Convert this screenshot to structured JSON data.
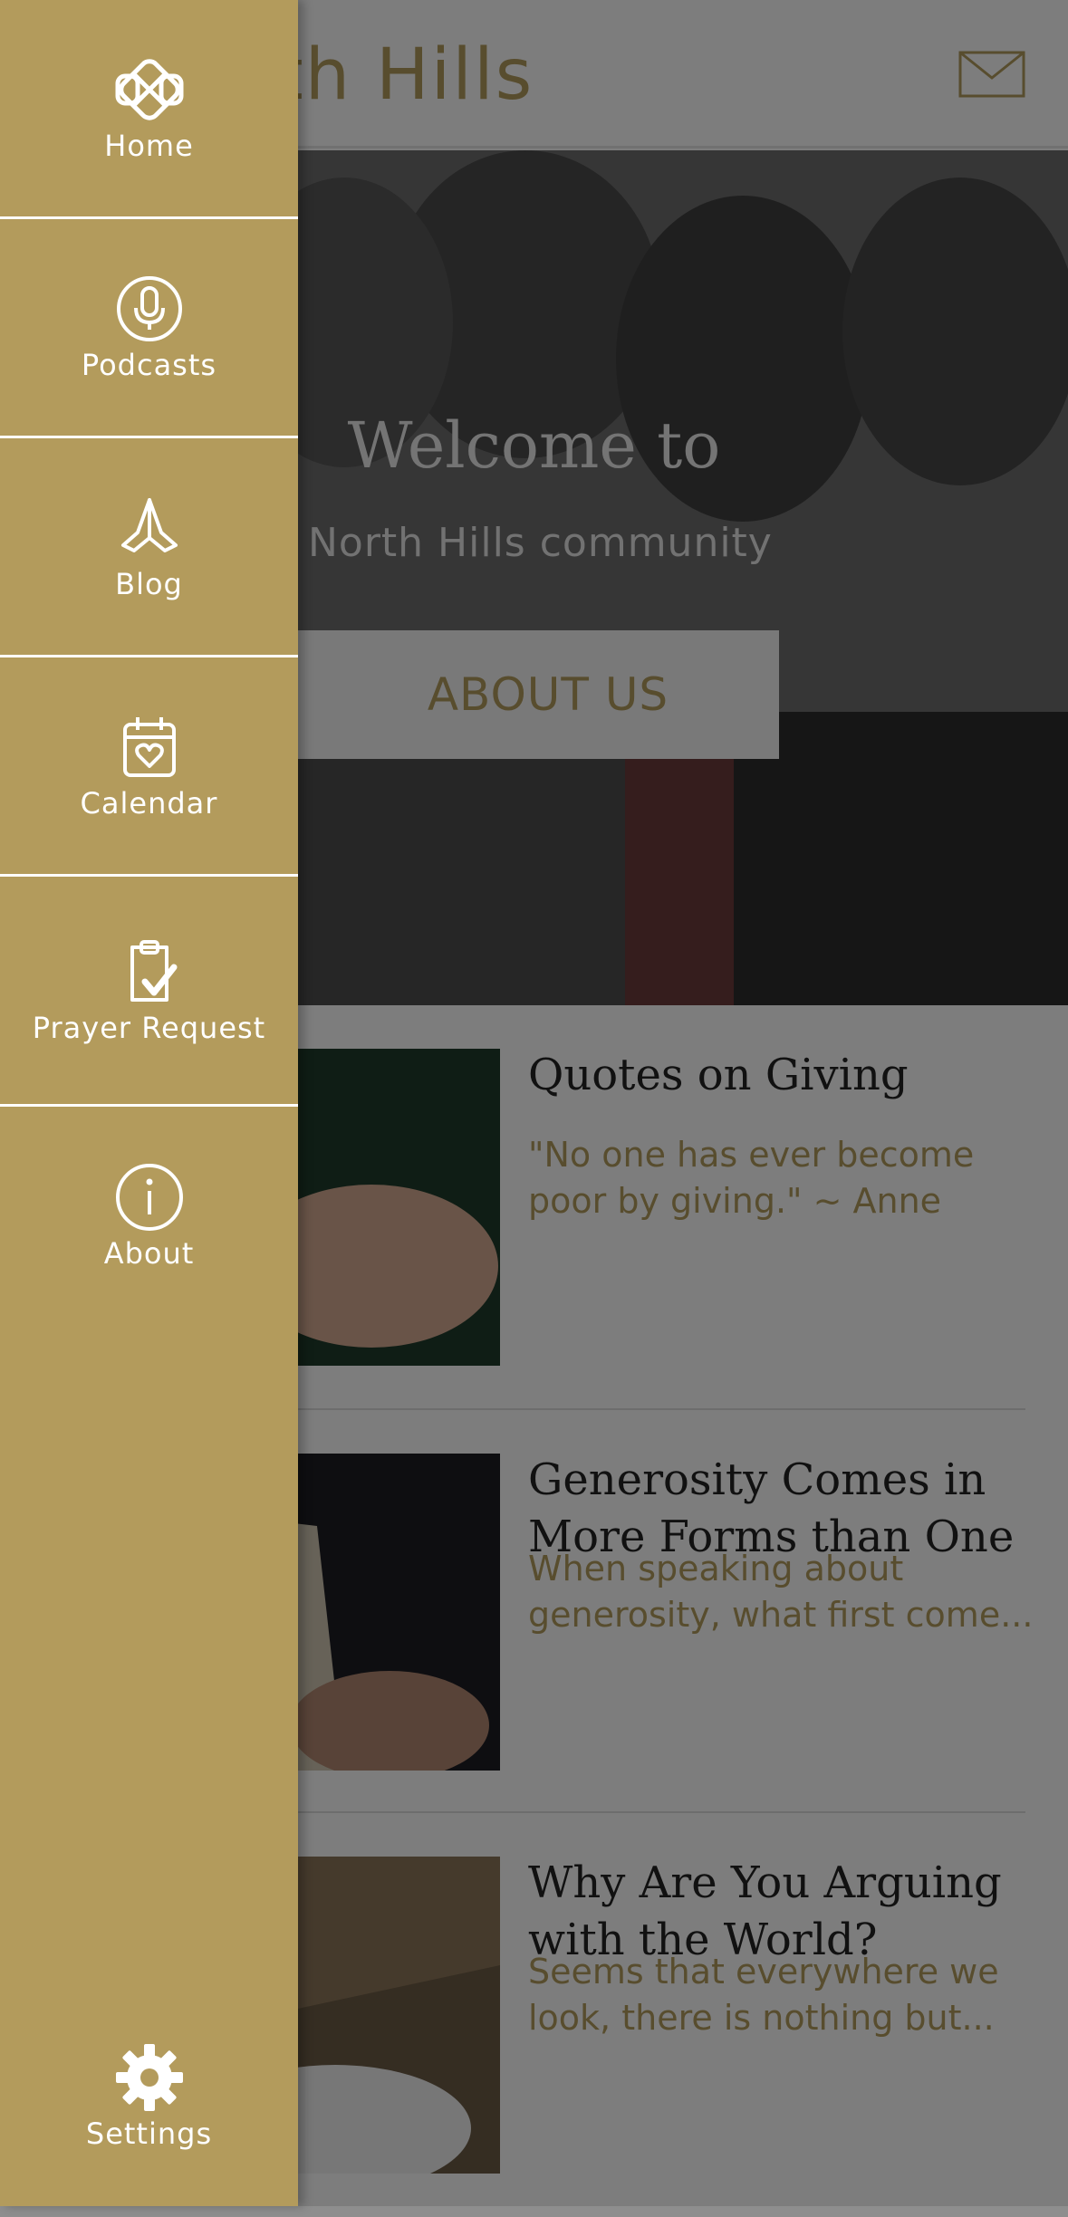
{
  "header": {
    "title": "North Hills",
    "mail_icon": "mail-icon"
  },
  "hero": {
    "welcome": "Welcome to",
    "subtitle": "North Hills community",
    "cta_label": "ABOUT US"
  },
  "posts": [
    {
      "title": "Quotes on Giving",
      "description": "\"No one has ever become poor by giving.\" ~ Anne Frank"
    },
    {
      "title": "Generosity Comes in More Forms than One",
      "description": "When speaking about generosity, what first come..."
    },
    {
      "title": "Why Are You Arguing with the World?",
      "description": "Seems that everywhere we look, there is nothing but..."
    }
  ],
  "drawer": {
    "items": [
      {
        "label": "Home",
        "icon": "knot-icon"
      },
      {
        "label": "Podcasts",
        "icon": "microphone-icon"
      },
      {
        "label": "Blog",
        "icon": "praying-hands-icon"
      },
      {
        "label": "Calendar",
        "icon": "calendar-heart-icon"
      },
      {
        "label": "Prayer Request",
        "icon": "clipboard-check-icon"
      },
      {
        "label": "About",
        "icon": "info-icon"
      }
    ],
    "settings_label": "Settings",
    "settings_icon": "gear-icon"
  },
  "colors": {
    "accent": "#b39b5c",
    "drawer_text": "#ffffff"
  }
}
